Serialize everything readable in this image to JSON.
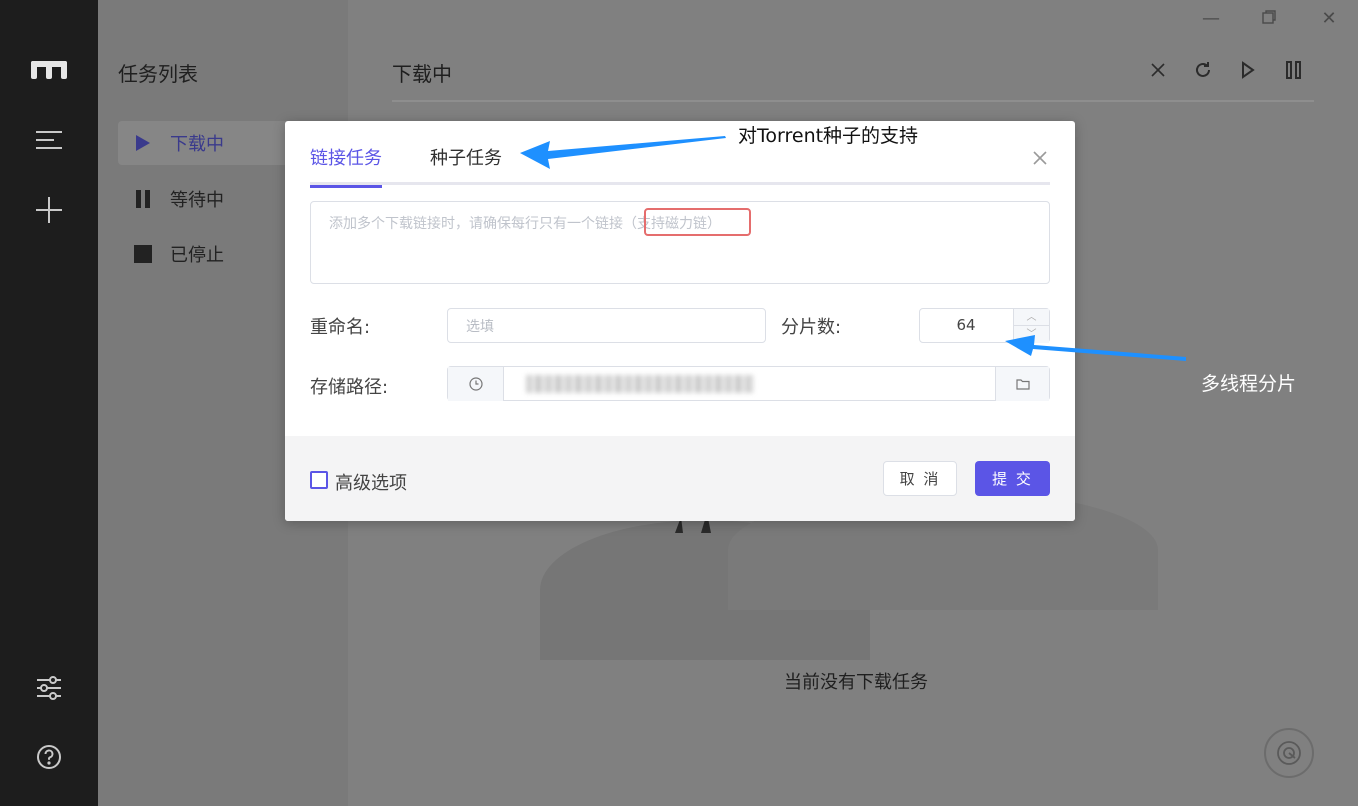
{
  "sidebar": {
    "title": "任务列表",
    "items": [
      {
        "label": "下载中",
        "icon": "play-icon"
      },
      {
        "label": "等待中",
        "icon": "pause-icon"
      },
      {
        "label": "已停止",
        "icon": "stop-icon"
      }
    ]
  },
  "main": {
    "title": "下载中",
    "empty_text": "当前没有下载任务"
  },
  "dialog": {
    "tabs": [
      "链接任务",
      "种子任务"
    ],
    "textarea_placeholder": "添加多个下载链接时，请确保每行只有一个链接（支持磁力链）",
    "rename_label": "重命名:",
    "rename_placeholder": "选填",
    "split_label": "分片数:",
    "split_value": "64",
    "path_label": "存储路径:",
    "advanced_label": "高级选项",
    "cancel_label": "取 消",
    "submit_label": "提 交"
  },
  "annotations": {
    "torrent": "对Torrent种子的支持",
    "multithread": "多线程分片"
  },
  "colors": {
    "accent": "#5b55e6",
    "highlight_box": "#e56d6d",
    "arrow": "#1e90ff"
  }
}
